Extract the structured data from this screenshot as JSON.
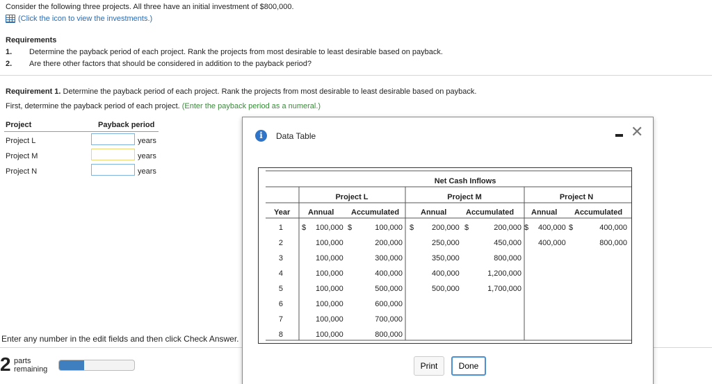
{
  "intro": "Consider the following three projects. All three have an initial investment of $800,000.",
  "investments_link": "(Click the icon to view the investments.)",
  "requirements": {
    "title": "Requirements",
    "items": [
      {
        "num": "1.",
        "text": "Determine the payback period of each project. Rank the projects from most desirable to least desirable based on payback."
      },
      {
        "num": "2.",
        "text": "Are there other factors that should be considered in addition to the payback period?"
      }
    ]
  },
  "requirement1": {
    "label": "Requirement 1.",
    "text": " Determine the payback period of each project. Rank the projects from most desirable to least desirable based on payback."
  },
  "instruction": {
    "text": "First, determine the payback period of each project. ",
    "hint": "(Enter the payback period as a numeral.)"
  },
  "payback_table": {
    "col_project": "Project",
    "col_period": "Payback period",
    "unit": "years",
    "rows": [
      {
        "project": "Project L",
        "value": ""
      },
      {
        "project": "Project M",
        "value": ""
      },
      {
        "project": "Project N",
        "value": ""
      }
    ]
  },
  "enter_hint": "Enter any number in the edit fields and then click Check Answer.",
  "parts": {
    "count": "2",
    "label_line1": "parts",
    "label_line2": "remaining",
    "progress_fraction": 0.33
  },
  "modal": {
    "title": "Data Table",
    "table": {
      "super_header": "Net Cash Inflows",
      "projects": [
        "Project L",
        "Project M",
        "Project N"
      ],
      "col_year": "Year",
      "col_annual": "Annual",
      "col_accumulated": "Accumulated",
      "dollar": "$",
      "rows": [
        {
          "year": "1",
          "l_annual": "100,000",
          "l_acc": "100,000",
          "m_annual": "200,000",
          "m_acc": "200,000",
          "n_annual": "400,000",
          "n_acc": "400,000"
        },
        {
          "year": "2",
          "l_annual": "100,000",
          "l_acc": "200,000",
          "m_annual": "250,000",
          "m_acc": "450,000",
          "n_annual": "400,000",
          "n_acc": "800,000"
        },
        {
          "year": "3",
          "l_annual": "100,000",
          "l_acc": "300,000",
          "m_annual": "350,000",
          "m_acc": "800,000",
          "n_annual": "",
          "n_acc": ""
        },
        {
          "year": "4",
          "l_annual": "100,000",
          "l_acc": "400,000",
          "m_annual": "400,000",
          "m_acc": "1,200,000",
          "n_annual": "",
          "n_acc": ""
        },
        {
          "year": "5",
          "l_annual": "100,000",
          "l_acc": "500,000",
          "m_annual": "500,000",
          "m_acc": "1,700,000",
          "n_annual": "",
          "n_acc": ""
        },
        {
          "year": "6",
          "l_annual": "100,000",
          "l_acc": "600,000",
          "m_annual": "",
          "m_acc": "",
          "n_annual": "",
          "n_acc": ""
        },
        {
          "year": "7",
          "l_annual": "100,000",
          "l_acc": "700,000",
          "m_annual": "",
          "m_acc": "",
          "n_annual": "",
          "n_acc": ""
        },
        {
          "year": "8",
          "l_annual": "100,000",
          "l_acc": "800,000",
          "m_annual": "",
          "m_acc": "",
          "n_annual": "",
          "n_acc": ""
        }
      ]
    },
    "print_label": "Print",
    "done_label": "Done"
  }
}
